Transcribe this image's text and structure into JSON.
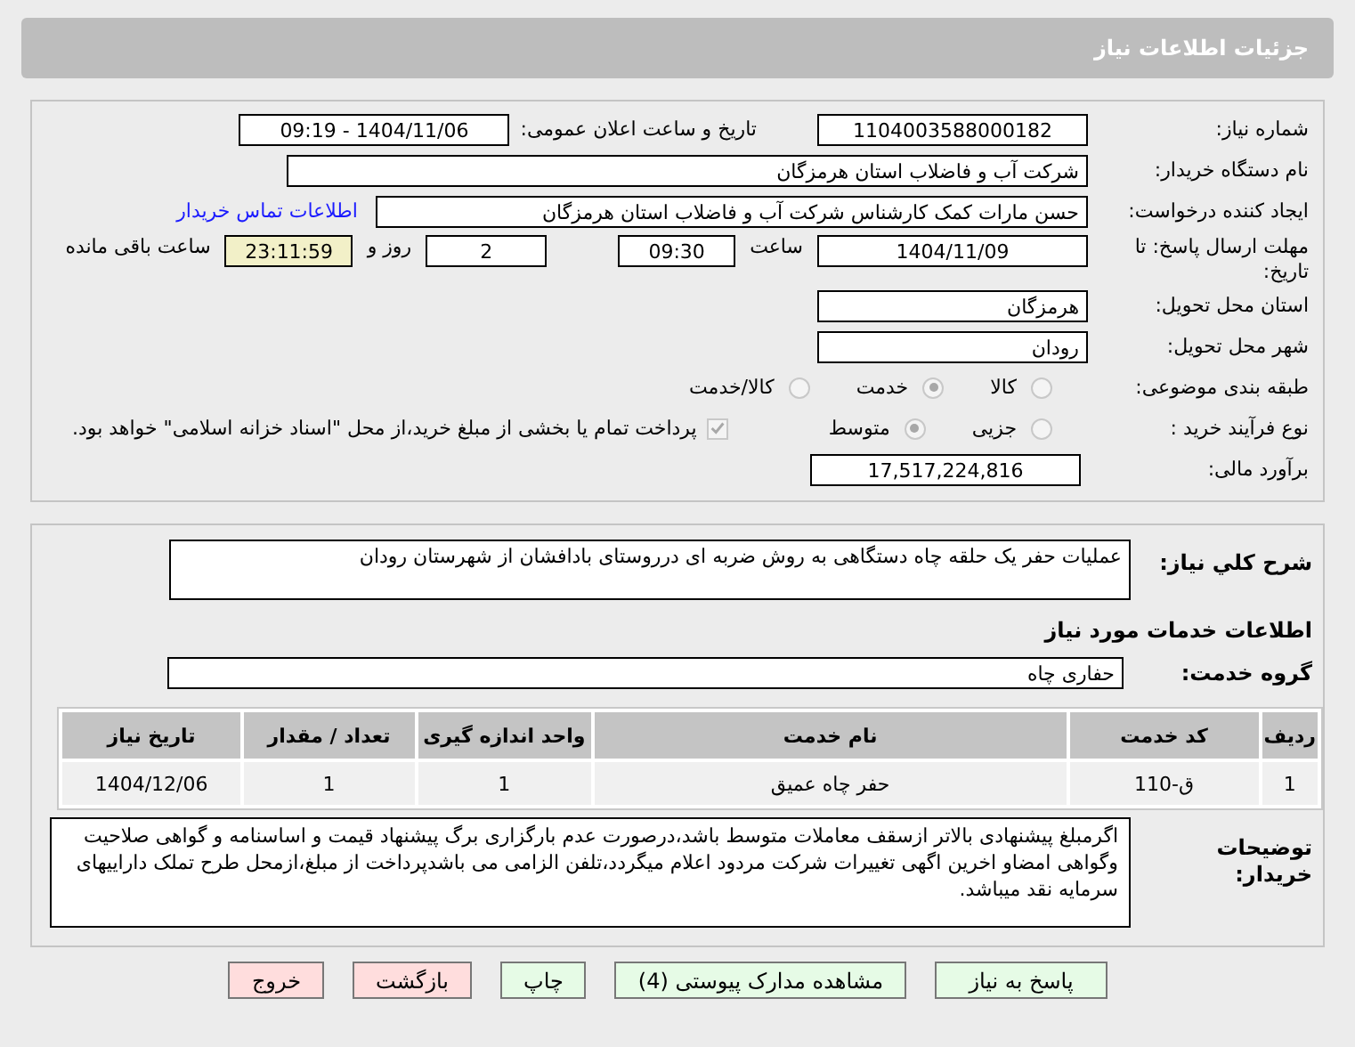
{
  "header": {
    "title": "جزئیات اطلاعات نیاز"
  },
  "need_number": {
    "label": "شماره نیاز:",
    "value": "1104003588000182"
  },
  "announce": {
    "label": "تاریخ و ساعت اعلان عمومی:",
    "value": "1404/11/06 - 09:19"
  },
  "buyer": {
    "label": "نام دستگاه خریدار:",
    "value": "شرکت آب و فاضلاب استان هرمزگان"
  },
  "requester": {
    "label": "ایجاد کننده درخواست:",
    "value": "حسن مارات کمک کارشناس شرکت آب و فاضلاب استان هرمزگان",
    "link": "اطلاعات تماس خریدار"
  },
  "deadline": {
    "label": "مهلت ارسال پاسخ: تا تاریخ:",
    "date": "1404/11/09",
    "time_label": "ساعت",
    "time": "09:30",
    "days": "2",
    "days_label": "روز و",
    "remaining": "23:11:59",
    "remaining_label": "ساعت باقی مانده"
  },
  "province": {
    "label": "استان محل تحویل:",
    "value": "هرمزگان"
  },
  "city": {
    "label": "شهر محل تحویل:",
    "value": "رودان"
  },
  "category": {
    "label": "طبقه بندی موضوعی:",
    "options": [
      {
        "label": "کالا",
        "selected": false
      },
      {
        "label": "خدمت",
        "selected": true
      },
      {
        "label": "کالا/خدمت",
        "selected": false
      }
    ]
  },
  "purchase_type": {
    "label": "نوع فرآیند خرید :",
    "options": [
      {
        "label": "جزیی",
        "selected": false
      },
      {
        "label": "متوسط",
        "selected": true
      }
    ],
    "payment_note": {
      "text": "پرداخت تمام یا بخشی از مبلغ خرید،از محل \"اسناد خزانه اسلامی\" خواهد بود.",
      "checked": true
    }
  },
  "estimate": {
    "label": "برآورد مالی:",
    "value": "17,517,224,816"
  },
  "summary": {
    "label": "شرح کلي نياز:",
    "value": "عملیات حفر یک حلقه چاه دستگاهی به روش ضربه ای درروستای بادافشان از شهرستان رودان"
  },
  "services_title": "اطلاعات خدمات مورد نیاز",
  "service_group": {
    "label": "گروه خدمت:",
    "value": "حفاری چاه"
  },
  "table": {
    "columns": [
      "ردیف",
      "کد خدمت",
      "نام خدمت",
      "واحد اندازه گیری",
      "تعداد / مقدار",
      "تاریخ نیاز"
    ],
    "rows": [
      [
        "1",
        "ق-110",
        "حفر چاه عمیق",
        "1",
        "1",
        "1404/12/06"
      ]
    ]
  },
  "buyer_notes": {
    "label": "توضیحات خریدار:",
    "value": "اگرمبلغ پیشنهادی بالاتر ازسقف معاملات متوسط باشد،درصورت عدم بارگزاری برگ پیشنهاد قیمت و اساسنامه و گواهی صلاحیت وگواهی امضاو اخرین اگهی تغییرات شرکت مردود اعلام میگردد،تلفن الزامی می باشدپرداخت از مبلغ،ازمحل طرح تملک داراییهای سرمایه نقد میباشد."
  },
  "buttons": [
    {
      "label": "پاسخ به نیاز",
      "kind": "go"
    },
    {
      "label": "مشاهده مدارک پیوستی (4)",
      "kind": "go"
    },
    {
      "label": "چاپ",
      "kind": "go"
    },
    {
      "label": "بازگشت",
      "kind": "stop"
    },
    {
      "label": "خروج",
      "kind": "stop"
    }
  ]
}
